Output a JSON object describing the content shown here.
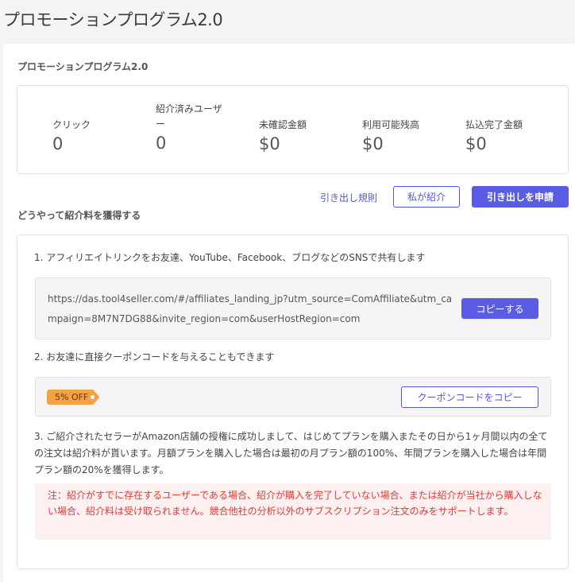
{
  "page": {
    "title": "プロモーションプログラム2.0"
  },
  "panel": {
    "title": "プロモーションプログラム2.0"
  },
  "stats": [
    {
      "label": "クリック",
      "value": "0"
    },
    {
      "label": "紹介済みユーザー",
      "value": "0"
    },
    {
      "label": "未確認金額",
      "value": "$0"
    },
    {
      "label": "利用可能残高",
      "value": "$0"
    },
    {
      "label": "払込完了金額",
      "value": "$0"
    }
  ],
  "actions": {
    "rules_label": "引き出し規則",
    "my_referral_label": "私が紹介",
    "withdraw_label": "引き出しを申請"
  },
  "how": {
    "title": "どうやって紹介料を獲得する",
    "step1": "1. アフィリエイトリンクをお友達、YouTube、Facebook、ブログなどのSNSで共有します",
    "link_url": "https://das.tool4seller.com/#/affiliates_landing_jp?utm_source=ComAffiliate&utm_campaign=8M7N7DG88&invite_region=com&userHostRegion=com",
    "copy_label": "コピーする",
    "step2": "2. お友達に直接クーポンコードを与えることもできます",
    "coupon_tag": "5% OFF",
    "copy_coupon_label": "クーポンコードをコピー",
    "step3": "3. ご紹介されたセラーがAmazon店舗の授権に成功しまして、はじめてプランを購入またその日から1ヶ月間以内の全ての注文は紹介料が貰います。月額プランを購入した場合は最初の月プラン額の100%、年間プランを購入した場合は年間プラン額の20%を獲得します。",
    "note": "注：紹介がすでに存在するユーザーである場合、紹介が購入を完了していない場合、または紹介が当社から購入しない場合、紹介料は受け取られません。競合他社の分析以外のサブスクリプション注文のみをサポートします。"
  },
  "colors": {
    "accent": "#5b5ce6",
    "warning": "#f4a244",
    "error": "#e53935"
  }
}
